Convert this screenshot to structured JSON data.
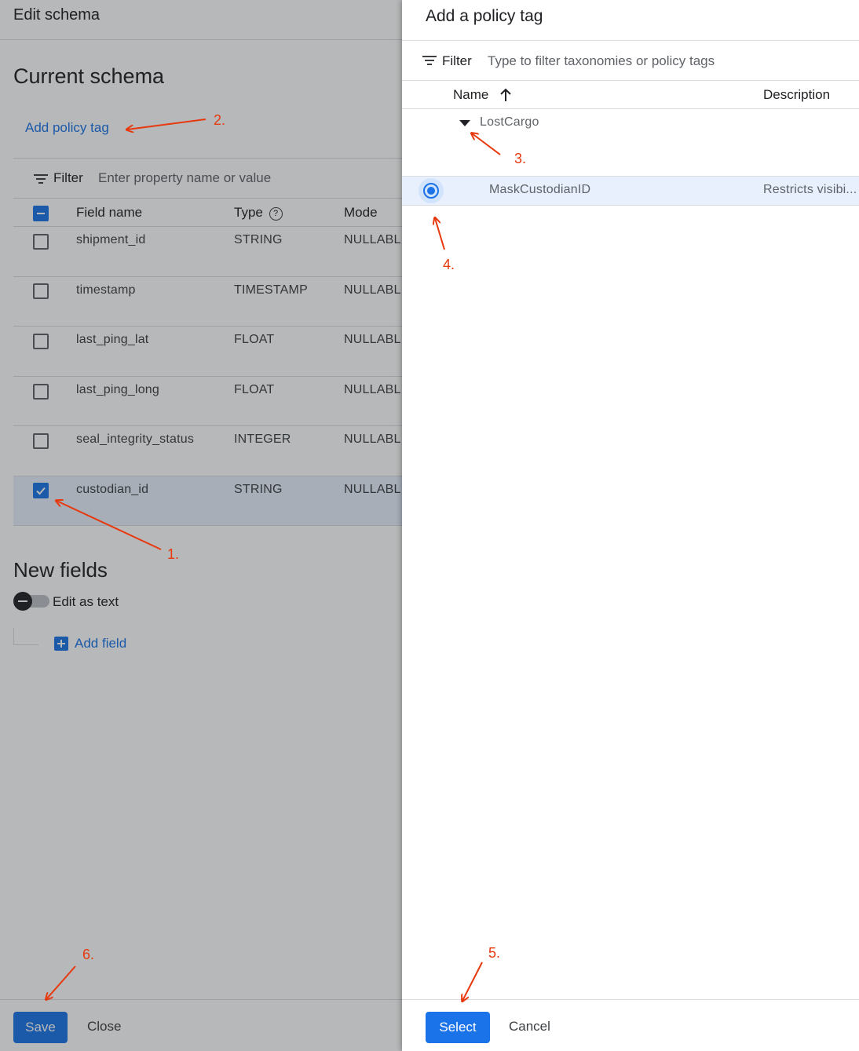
{
  "edit_schema": {
    "title": "Edit schema",
    "section_title": "Current schema",
    "add_policy_tag_link": "Add policy tag",
    "filter": {
      "label": "Filter",
      "placeholder": "Enter property name or value"
    },
    "columns": {
      "field_name": "Field name",
      "type": "Type",
      "mode": "Mode"
    },
    "rows": [
      {
        "name": "shipment_id",
        "type": "STRING",
        "mode": "NULLABL",
        "checked": false
      },
      {
        "name": "timestamp",
        "type": "TIMESTAMP",
        "mode": "NULLABL",
        "checked": false
      },
      {
        "name": "last_ping_lat",
        "type": "FLOAT",
        "mode": "NULLABL",
        "checked": false
      },
      {
        "name": "last_ping_long",
        "type": "FLOAT",
        "mode": "NULLABL",
        "checked": false
      },
      {
        "name": "seal_integrity_status",
        "type": "INTEGER",
        "mode": "NULLABL",
        "checked": false
      },
      {
        "name": "custodian_id",
        "type": "STRING",
        "mode": "NULLABL",
        "checked": true
      }
    ],
    "new_fields_title": "New fields",
    "edit_as_text_label": "Edit as text",
    "add_field_label": "Add field",
    "footer": {
      "save_label": "Save",
      "close_label": "Close"
    }
  },
  "policy_tag_panel": {
    "title": "Add a policy tag",
    "filter": {
      "label": "Filter",
      "placeholder": "Type to filter taxonomies or policy tags"
    },
    "columns": {
      "name": "Name",
      "description": "Description"
    },
    "taxonomy": {
      "name": "LostCargo",
      "expanded": true
    },
    "tags": [
      {
        "name": "MaskCustodianID",
        "description": "Restricts visibi...",
        "selected": true
      }
    ],
    "footer": {
      "select_label": "Select",
      "cancel_label": "Cancel"
    }
  },
  "annotations": {
    "step1": "1.",
    "step2": "2.",
    "step3": "3.",
    "step4": "4.",
    "step5": "5.",
    "step6": "6."
  },
  "colors": {
    "accent": "#1a73e8",
    "annotation": "#e8380d",
    "selected_row": "#e8f0fe"
  }
}
